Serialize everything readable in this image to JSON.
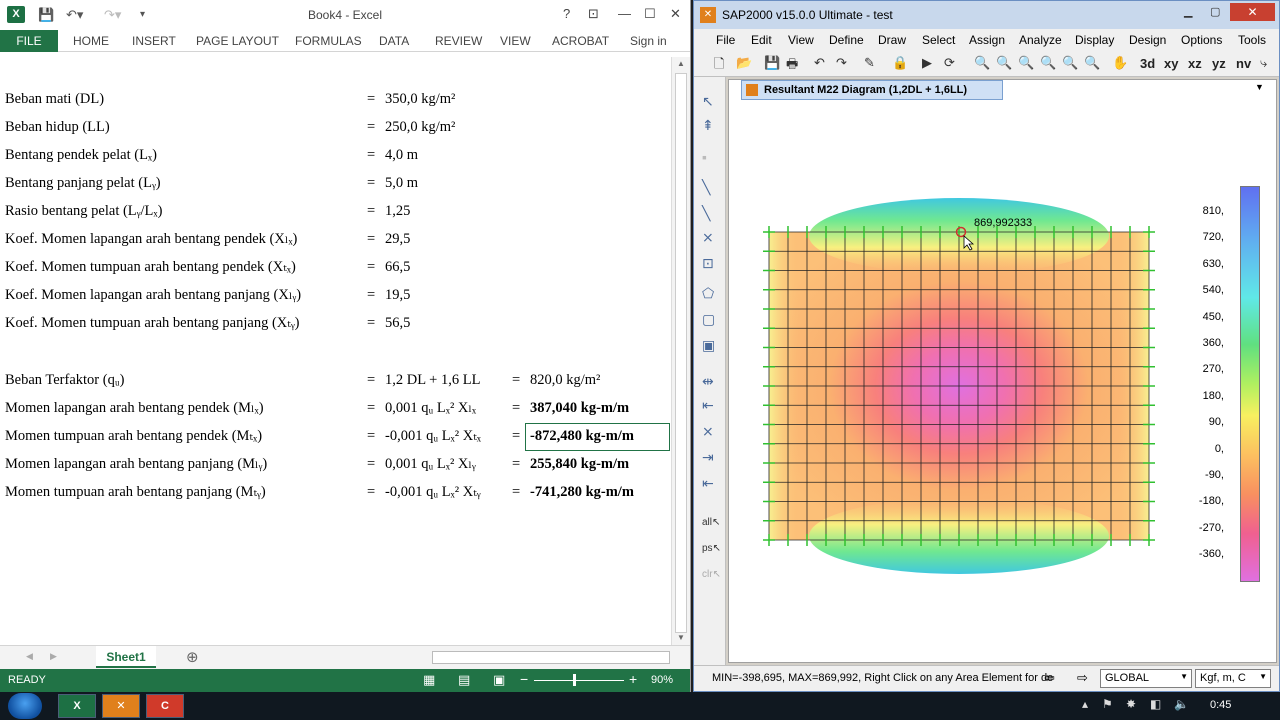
{
  "excel": {
    "doc_title": "Book4 - Excel",
    "file_tab": "FILE",
    "tabs": [
      "HOME",
      "INSERT",
      "PAGE LAYOUT",
      "FORMULAS",
      "DATA",
      "REVIEW",
      "VIEW",
      "ACROBAT"
    ],
    "sign_in": "Sign in",
    "sheet_tab": "Sheet1",
    "status": "READY",
    "zoom": "90%",
    "rows": [
      {
        "label": "Beban mati (DL)",
        "eq": "=",
        "val": "350,0 kg/m²"
      },
      {
        "label": "Beban hidup (LL)",
        "eq": "=",
        "val": "250,0 kg/m²"
      },
      {
        "label": "Bentang pendek pelat (Lₓ)",
        "eq": "=",
        "val": "4,0 m"
      },
      {
        "label": "Bentang panjang pelat (Lᵧ)",
        "eq": "=",
        "val": "5,0 m"
      },
      {
        "label": "Rasio bentang pelat (Lᵧ/Lₓ)",
        "eq": "=",
        "val": "1,25"
      },
      {
        "label": "Koef. Momen lapangan arah bentang pendek (Xₗₓ)",
        "eq": "=",
        "val": "29,5"
      },
      {
        "label": "Koef. Momen tumpuan arah bentang pendek (Xₜₓ)",
        "eq": "=",
        "val": "66,5"
      },
      {
        "label": "Koef. Momen lapangan arah bentang panjang (Xₗᵧ)",
        "eq": "=",
        "val": "19,5"
      },
      {
        "label": "Koef. Momen tumpuan arah bentang panjang (Xₜᵧ)",
        "eq": "=",
        "val": "56,5"
      }
    ],
    "results": [
      {
        "label": "Beban Terfaktor (qᵤ)",
        "eq": "=",
        "val": "1,2 DL + 1,6 LL",
        "eq2": "=",
        "res": "820,0 kg/m²"
      },
      {
        "label": "Momen lapangan arah bentang pendek (Mₗₓ)",
        "eq": "=",
        "val": "0,001 qᵤ Lₓ² Xₗₓ",
        "eq2": "=",
        "res": "387,040 kg-m/m"
      },
      {
        "label": "Momen tumpuan arah bentang pendek (Mₜₓ)",
        "eq": "=",
        "val": "-0,001 qᵤ Lₓ² Xₜₓ",
        "eq2": "=",
        "res": "-872,480 kg-m/m"
      },
      {
        "label": "Momen lapangan arah bentang panjang (Mₗᵧ)",
        "eq": "=",
        "val": "0,001 qᵤ Lₓ² Xₗᵧ",
        "eq2": "=",
        "res": "255,840 kg-m/m"
      },
      {
        "label": "Momen tumpuan arah bentang panjang (Mₜᵧ)",
        "eq": "=",
        "val": "-0,001 qᵤ Lₓ² Xₜᵧ",
        "eq2": "=",
        "res": "-741,280 kg-m/m"
      }
    ]
  },
  "sap": {
    "title": "SAP2000 v15.0.0 Ultimate  - test",
    "menu": [
      "File",
      "Edit",
      "View",
      "Define",
      "Draw",
      "Select",
      "Assign",
      "Analyze",
      "Display",
      "Design",
      "Options",
      "Tools"
    ],
    "toolbar_text": [
      "xy",
      "xz",
      "yz",
      "nv"
    ],
    "view_tab": "Resultant M22 Diagram   (1,2DL + 1,6LL)",
    "annotation": "869,992333",
    "scale": [
      "810,",
      "720,",
      "630,",
      "540,",
      "450,",
      "360,",
      "270,",
      "180,",
      "90,",
      "0,",
      "-90,",
      "-180,",
      "-270,",
      "-360,"
    ],
    "status_msg": "MIN=-398,695, MAX=869,992, Right Click on any Area Element for de",
    "coord_sys": "GLOBAL",
    "units": "Kgf, m, C"
  },
  "taskbar": {
    "clock": "0:45"
  }
}
